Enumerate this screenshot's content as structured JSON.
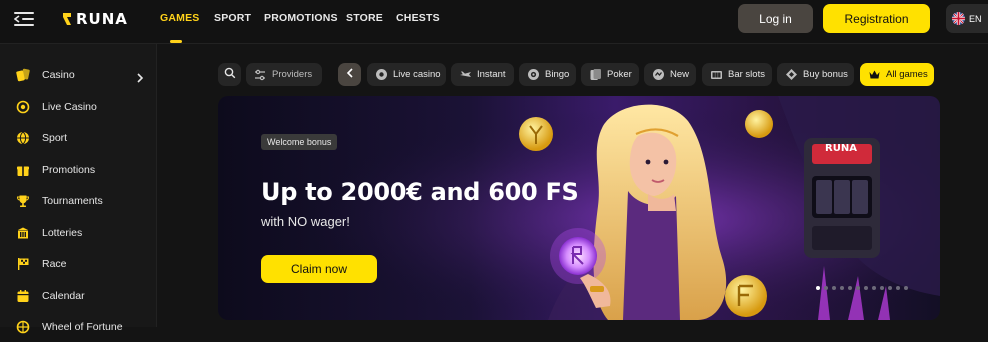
{
  "brand": {
    "name": "RUNA"
  },
  "topnav": {
    "items": [
      "GAMES",
      "SPORT",
      "PROMOTIONS",
      "STORE",
      "CHESTS"
    ],
    "active": "GAMES"
  },
  "auth": {
    "login_label": "Log in",
    "register_label": "Registration"
  },
  "language": {
    "code": "EN",
    "icon": "uk-flag-icon"
  },
  "sidebar": {
    "items": [
      {
        "label": "Casino",
        "icon": "cards-icon",
        "has_submenu": true
      },
      {
        "label": "Live Casino",
        "icon": "live-icon"
      },
      {
        "label": "Sport",
        "icon": "ball-icon"
      },
      {
        "label": "Promotions",
        "icon": "gift-icon"
      },
      {
        "label": "Tournaments",
        "icon": "trophy-icon"
      },
      {
        "label": "Lotteries",
        "icon": "ticket-icon"
      },
      {
        "label": "Race",
        "icon": "flag-icon"
      },
      {
        "label": "Calendar",
        "icon": "calendar-icon"
      },
      {
        "label": "Wheel of Fortune",
        "icon": "wheel-icon"
      }
    ]
  },
  "filters": {
    "search_icon": "search-icon",
    "providers_label": "Providers",
    "categories": [
      {
        "label": "Live casino",
        "icon": "live-icon"
      },
      {
        "label": "Instant",
        "icon": "plane-icon"
      },
      {
        "label": "Bingo",
        "icon": "bingo-icon"
      },
      {
        "label": "Poker",
        "icon": "poker-icon"
      },
      {
        "label": "New",
        "icon": "new-icon"
      },
      {
        "label": "Bar slots",
        "icon": "slots-icon"
      },
      {
        "label": "Buy bonus",
        "icon": "diamond-icon"
      },
      {
        "label": "All games",
        "icon": "crown-icon",
        "active": true
      }
    ]
  },
  "hero": {
    "badge": "Welcome bonus",
    "title": "Up to 2000€ and 600 FS",
    "subtitle": "with NO wager!",
    "cta_label": "Claim now",
    "slot_sign": "RUNA",
    "slide_count": 12,
    "active_slide": 1
  },
  "colors": {
    "accent": "#ffe100",
    "active_nav": "#ffd21a",
    "panel": "#262626",
    "background": "#141414"
  }
}
